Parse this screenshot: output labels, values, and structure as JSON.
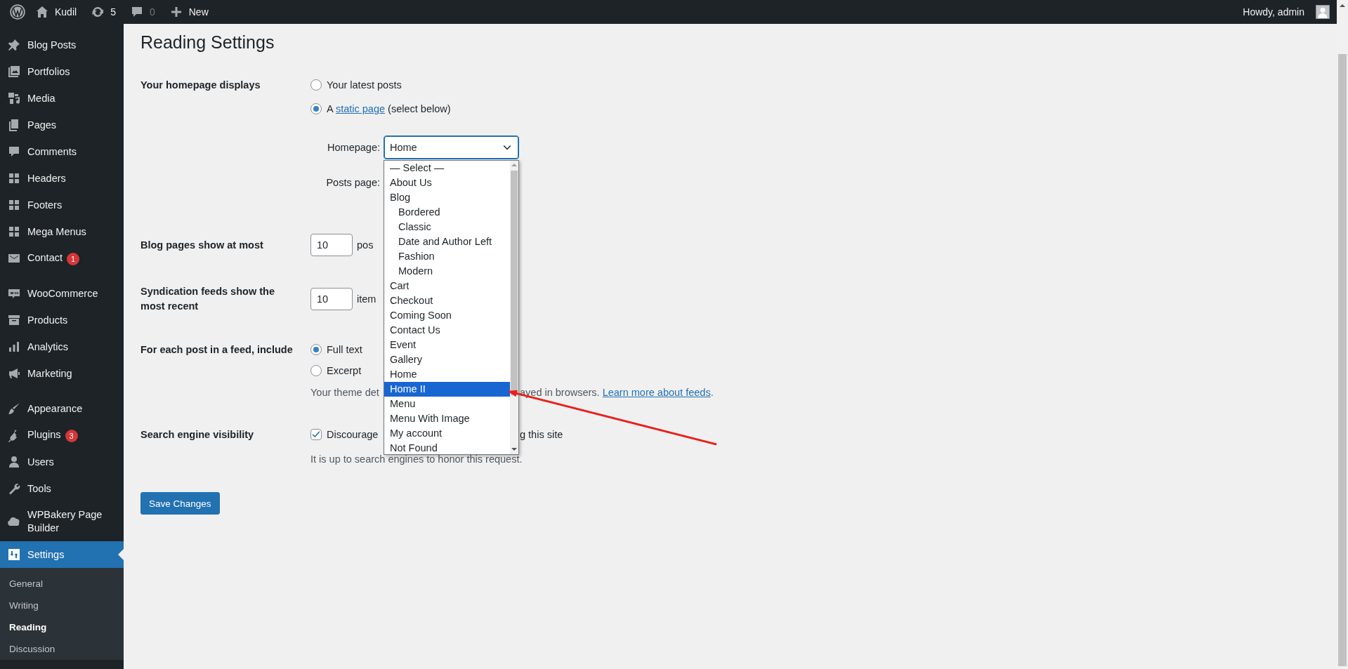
{
  "admin_bar": {
    "site": "Kudil",
    "updates": "5",
    "comments": "0",
    "new": "New",
    "greeting": "Howdy, admin"
  },
  "sidebar": {
    "groups": [
      [
        {
          "label": "Blog Posts",
          "selected": false
        },
        {
          "label": "Portfolios",
          "selected": false
        },
        {
          "label": "Media",
          "selected": false
        },
        {
          "label": "Pages",
          "selected": false
        },
        {
          "label": "Comments",
          "selected": false
        },
        {
          "label": "Headers",
          "selected": false
        },
        {
          "label": "Footers",
          "selected": false
        },
        {
          "label": "Mega Menus",
          "selected": false
        },
        {
          "label": "Contact",
          "badge": "1",
          "selected": false
        }
      ],
      [
        {
          "label": "WooCommerce",
          "selected": false
        },
        {
          "label": "Products",
          "selected": false
        },
        {
          "label": "Analytics",
          "selected": false
        },
        {
          "label": "Marketing",
          "selected": false
        }
      ],
      [
        {
          "label": "Appearance",
          "selected": false
        },
        {
          "label": "Plugins",
          "badge": "3",
          "selected": false
        },
        {
          "label": "Users",
          "selected": false
        },
        {
          "label": "Tools",
          "selected": false
        },
        {
          "label": "WPBakery Page Builder",
          "selected": false
        },
        {
          "label": "Settings",
          "selected": true,
          "submenu": [
            {
              "label": "General",
              "selected": false
            },
            {
              "label": "Writing",
              "selected": false
            },
            {
              "label": "Reading",
              "selected": true
            },
            {
              "label": "Discussion",
              "selected": false
            }
          ]
        }
      ]
    ]
  },
  "page": {
    "title": "Reading Settings",
    "homepage_displays": {
      "label": "Your homepage displays",
      "options": [
        {
          "kind": "plain",
          "text": "Your latest posts",
          "selected": false
        },
        {
          "kind": "link",
          "before": "A",
          "link": "static page",
          "after": "(select below)",
          "selected": true
        }
      ],
      "homepage_label": "Homepage:",
      "homepage_value": "Home",
      "posts_page_label": "Posts page:"
    },
    "dropdown": {
      "options": [
        {
          "label": "— Select —",
          "selected": false
        },
        {
          "label": "About Us",
          "selected": false
        },
        {
          "label": "Blog",
          "selected": false,
          "children": [
            {
              "label": "Bordered",
              "selected": false
            },
            {
              "label": "Classic",
              "selected": false
            },
            {
              "label": "Date and Author Left",
              "selected": false
            },
            {
              "label": "Fashion",
              "selected": false
            },
            {
              "label": "Modern",
              "selected": false
            }
          ]
        },
        {
          "label": "Cart",
          "selected": false
        },
        {
          "label": "Checkout",
          "selected": false
        },
        {
          "label": "Coming Soon",
          "selected": false
        },
        {
          "label": "Contact Us",
          "selected": false
        },
        {
          "label": "Event",
          "selected": false
        },
        {
          "label": "Gallery",
          "selected": false
        },
        {
          "label": "Home",
          "selected": false
        },
        {
          "label": "Home II",
          "selected": true
        },
        {
          "label": "Menu",
          "selected": false
        },
        {
          "label": "Menu With Image",
          "selected": false
        },
        {
          "label": "My account",
          "selected": false
        },
        {
          "label": "Not Found",
          "selected": false
        }
      ]
    },
    "blog_pages": {
      "label": "Blog pages show at most",
      "value": "10",
      "suffix": "pos"
    },
    "syndication": {
      "label": "Syndication feeds show the most recent",
      "value": "10",
      "suffix": "item"
    },
    "feed_include": {
      "label": "For each post in a feed, include",
      "options": [
        {
          "text": "Full text",
          "selected": true
        },
        {
          "text": "Excerpt",
          "selected": false
        }
      ],
      "note_start": "Your theme det",
      "note_end": "ayed in browsers.",
      "note_link": "Learn more about feeds",
      "note_tail": "."
    },
    "search_visibility": {
      "label": "Search engine visibility",
      "checked": true,
      "text_start": "Discourage",
      "text_end": "g this site",
      "note": "It is up to search engines to honor this request."
    },
    "save_button": "Save Changes"
  }
}
